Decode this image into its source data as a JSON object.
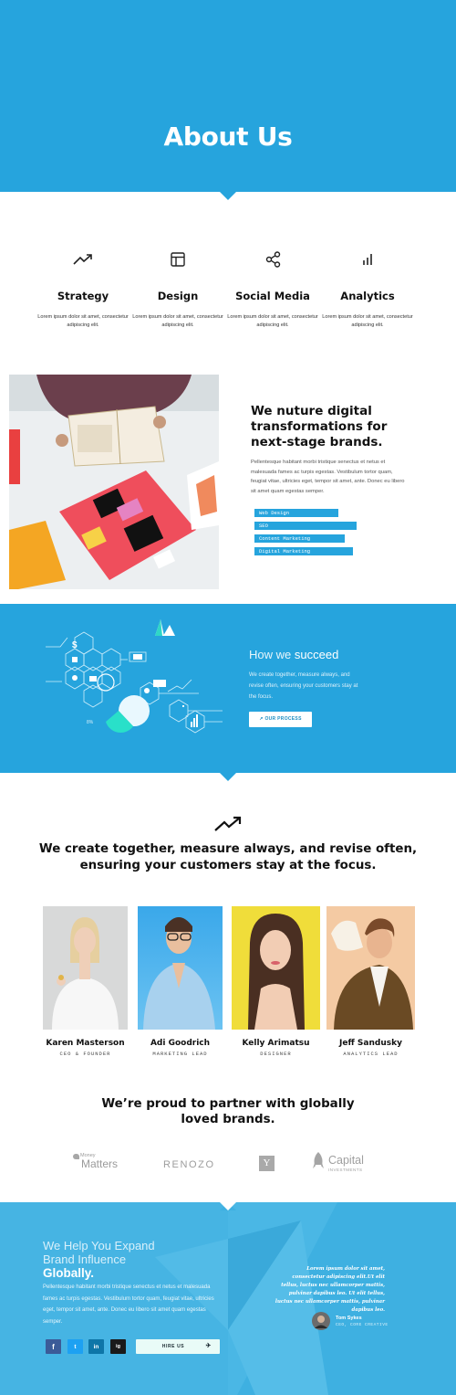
{
  "hero": {
    "title": "About Us"
  },
  "services": [
    {
      "icon": "trending-up-icon",
      "title": "Strategy",
      "desc": "Lorem ipsum dolor sit amet, consectetur adipiscing elit."
    },
    {
      "icon": "layout-icon",
      "title": "Design",
      "desc": "Lorem ipsum dolor sit amet, consectetur adipiscing elit."
    },
    {
      "icon": "share-icon",
      "title": "Social Media",
      "desc": "Lorem ipsum dolor sit amet, consectetur adipiscing elit."
    },
    {
      "icon": "bar-chart-icon",
      "title": "Analytics",
      "desc": "Lorem ipsum dolor sit amet, consectetur adipiscing elit."
    }
  ],
  "feature": {
    "title": "We nuture digital transformations for next-stage brands.",
    "body": "Pellentesque habitant morbi tristique senectus et netus et malesuada fames ac turpis egestas. Vestibulum tortor quam, feugiat vitae, ultricies eget, tempor sit amet, ante. Donec eu libero sit amet quam egestas semper.",
    "tags": [
      "Web Design",
      "SEO",
      "Content Marketing",
      "Digital Marketing"
    ],
    "tag_levels": [
      0.7,
      0.85,
      0.75,
      0.82
    ]
  },
  "succeed": {
    "title_light": "How we",
    "title_bold": "succeed",
    "body": "We create together, measure always, and revise often, ensuring your customers stay at the focus.",
    "button": "OUR PROCESS",
    "graphic_dollar": "$",
    "graphic_percent": "8%"
  },
  "motto": {
    "icon": "trending-up-icon",
    "text": "We create together, measure always, and revise often, ensuring your customers stay at the focus."
  },
  "team": [
    {
      "name": "Karen Masterson",
      "role": "CEO & FOUNDER"
    },
    {
      "name": "Adi Goodrich",
      "role": "MARKETING LEAD"
    },
    {
      "name": "Kelly Arimatsu",
      "role": "DESIGNER"
    },
    {
      "name": "Jeff Sandusky",
      "role": "ANALYTICS LEAD"
    }
  ],
  "partners": {
    "title": "We’re proud to partner with globally loved brands.",
    "logos": [
      {
        "small": "Money",
        "big": "Matters"
      },
      {
        "big": "RENOZO"
      },
      {
        "big": "Y"
      },
      {
        "big": "Capital",
        "small": "INVESTMENTS"
      }
    ]
  },
  "cta": {
    "line1": "We Help You Expand",
    "line2": "Brand Influence",
    "line3": "Globally.",
    "body": "Pellentesque habitant morbi tristique senectus et netus et malesuada fames ac turpis egestas. Vestibulum tortor quam, feugiat vitae, ultricies eget, tempor sit amet, ante. Donec eu libero sit amet quam egestas semper.",
    "socials": [
      "f",
      "t",
      "in",
      "ig"
    ],
    "hire_button": "HIRE US",
    "quote": "Lorem ipsum dolor sit amet, consectetur adipiscing elit.Ut elit tellus, luctus nec ullamcorper mattis, pulvinar dapibus leo. Ut elit tellus, luctus nec ullamcorper mattis, pulvinar dapibus leo.",
    "author_name": "Tom Sykes",
    "author_role": "CEO, CORE CREATIVE"
  },
  "colors": {
    "primary": "#26a4dd",
    "cta": "#3eb0e1"
  }
}
